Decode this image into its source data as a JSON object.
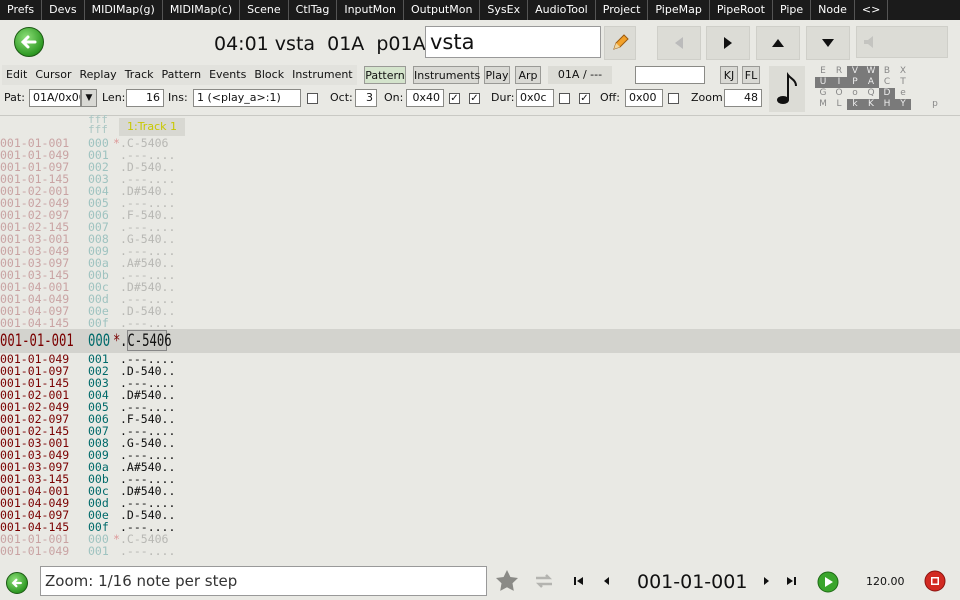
{
  "menubar": [
    "Prefs",
    "Devs",
    "MIDIMap(g)",
    "MIDIMap(c)",
    "Scene",
    "CtlTag",
    "InputMon",
    "OutputMon",
    "SysEx",
    "AudioTool",
    "Project",
    "PipeMap",
    "PipeRoot",
    "Pipe",
    "Node",
    "<>"
  ],
  "nav": {
    "position_title": "04:01 vsta  01A  p01A :",
    "name_value": "vsta"
  },
  "menus": [
    "Edit",
    "Cursor",
    "Replay",
    "Track",
    "Pattern",
    "Events",
    "Block",
    "Instrument"
  ],
  "tool_buttons": {
    "pattern": "Pattern",
    "instruments": "Instruments",
    "play": "Play",
    "arp": "Arp",
    "pattern_id": "01A / ---",
    "kj": "KJ",
    "fl": "FL"
  },
  "params": {
    "pat_label": "Pat:",
    "pat_value": "01A/0x00",
    "len_label": "Len:",
    "len_value": "16",
    "ins_label": "Ins:",
    "ins_value": "1 (<play_a>:1)",
    "oct_label": "Oct:",
    "oct_value": "3",
    "on_label": "On:",
    "on_value": "0x40",
    "dur_label": "Dur:",
    "dur_value": "0x0c",
    "off_label": "Off:",
    "off_value": "0x00",
    "zoom_label": "Zoom:",
    "zoom_value": "48"
  },
  "keygrid": [
    [
      "E",
      "R",
      "V",
      "W",
      "B",
      "X"
    ],
    [
      "U",
      "I",
      "P",
      "A",
      "C",
      "T"
    ],
    [
      "G",
      "O",
      "o",
      "Q",
      "D",
      "e"
    ],
    [
      "M",
      "L",
      "k",
      "K",
      "H",
      "Y",
      "p"
    ]
  ],
  "pattern": {
    "header_top": "fff",
    "header_bottom": "fff",
    "track_label": "1:Track 1",
    "rows": [
      {
        "ts": "001-01-001",
        "idx": "000",
        "mk": "*",
        "nt": ".C-5406"
      },
      {
        "ts": "001-01-049",
        "idx": "001",
        "mk": "",
        "nt": ".---...."
      },
      {
        "ts": "001-01-097",
        "idx": "002",
        "mk": "",
        "nt": ".D-540.."
      },
      {
        "ts": "001-01-145",
        "idx": "003",
        "mk": "",
        "nt": ".---...."
      },
      {
        "ts": "001-02-001",
        "idx": "004",
        "mk": "",
        "nt": ".D#540.."
      },
      {
        "ts": "001-02-049",
        "idx": "005",
        "mk": "",
        "nt": ".---...."
      },
      {
        "ts": "001-02-097",
        "idx": "006",
        "mk": "",
        "nt": ".F-540.."
      },
      {
        "ts": "001-02-145",
        "idx": "007",
        "mk": "",
        "nt": ".---...."
      },
      {
        "ts": "001-03-001",
        "idx": "008",
        "mk": "",
        "nt": ".G-540.."
      },
      {
        "ts": "001-03-049",
        "idx": "009",
        "mk": "",
        "nt": ".---...."
      },
      {
        "ts": "001-03-097",
        "idx": "00a",
        "mk": "",
        "nt": ".A#540.."
      },
      {
        "ts": "001-03-145",
        "idx": "00b",
        "mk": "",
        "nt": ".---...."
      },
      {
        "ts": "001-04-001",
        "idx": "00c",
        "mk": "",
        "nt": ".D#540.."
      },
      {
        "ts": "001-04-049",
        "idx": "00d",
        "mk": "",
        "nt": ".---...."
      },
      {
        "ts": "001-04-097",
        "idx": "00e",
        "mk": "",
        "nt": ".D-540.."
      },
      {
        "ts": "001-04-145",
        "idx": "00f",
        "mk": "",
        "nt": ".---...."
      }
    ],
    "current_row": {
      "ts": "001-01-001",
      "idx": "000",
      "mk": "*",
      "nt": ".C-5406"
    }
  },
  "bottom": {
    "status": "Zoom: 1/16 note per step",
    "position": "001-01-001",
    "tempo": "120.00"
  },
  "colors": {
    "accent_green": "#2f9a24",
    "record_red": "#d22a22",
    "timestamp_active": "#7a0000",
    "index_active": "#006a6a"
  },
  "icons": [
    "back-arrow-icon",
    "pencil-icon",
    "prev-icon",
    "play-icon",
    "up-arrow-icon",
    "down-arrow-icon",
    "volume-icon",
    "note-icon",
    "star-icon",
    "loop-icon",
    "skip-start-icon",
    "step-back-icon",
    "step-forward-icon",
    "skip-end-icon",
    "play-circle-icon",
    "record-stop-icon"
  ]
}
